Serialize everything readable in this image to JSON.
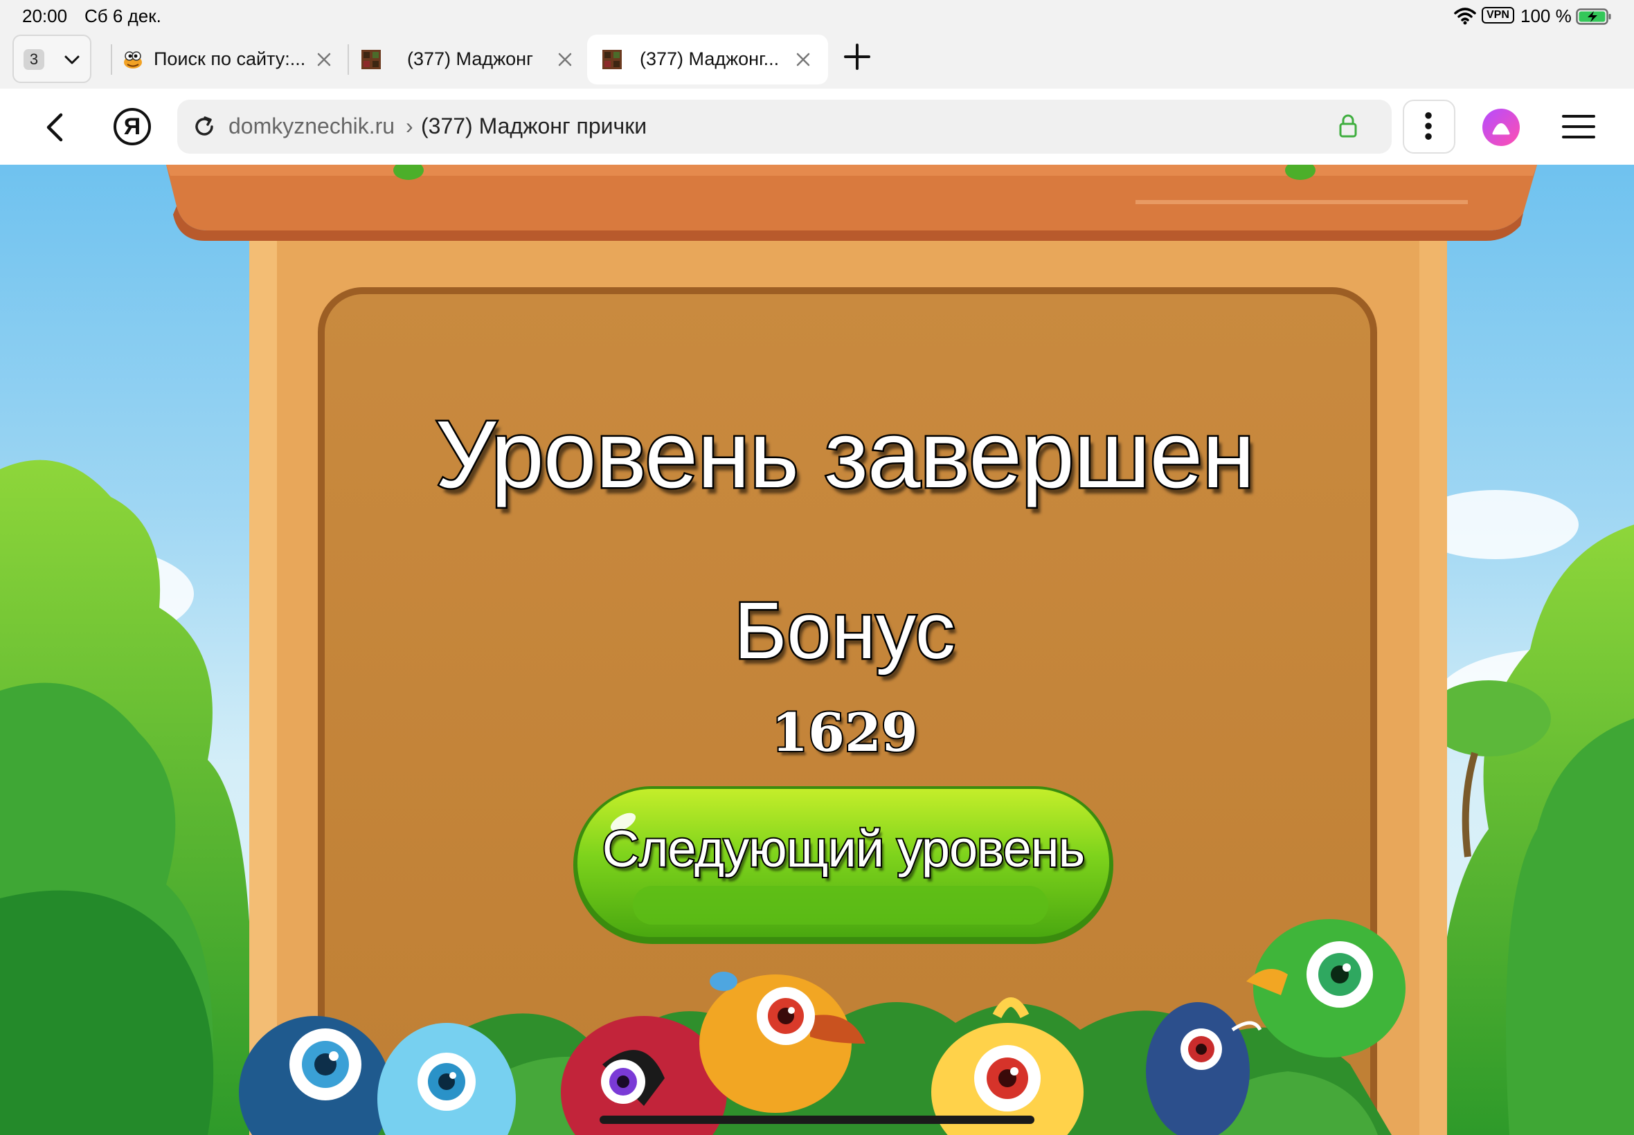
{
  "status_bar": {
    "time": "20:00",
    "date": "Сб 6 дек.",
    "vpn": "VPN",
    "battery": "100 %"
  },
  "tabs": {
    "count": "3",
    "items": [
      {
        "title": "Поиск по сайту:...",
        "favicon": "grasshopper-icon",
        "active": false
      },
      {
        "title": "(377) Маджонг",
        "favicon": "mahjong-tile-icon",
        "active": false
      },
      {
        "title": "(377) Маджонг...",
        "favicon": "mahjong-tile-icon",
        "active": true
      }
    ]
  },
  "address_bar": {
    "domain": "domkyznechik.ru",
    "separator": "›",
    "page_title": "(377) Маджонг прички",
    "yandex_logo": "Я"
  },
  "game": {
    "title": "Уровень завершен",
    "bonus_label": "Бонус",
    "bonus_value": "1629",
    "next_button": "Следующий уровень"
  },
  "colors": {
    "board": "#c4863c",
    "sign": "#d97a3e",
    "button_green": "#5ebd16",
    "alice": "#c24dff",
    "lock": "#3fae3f"
  }
}
